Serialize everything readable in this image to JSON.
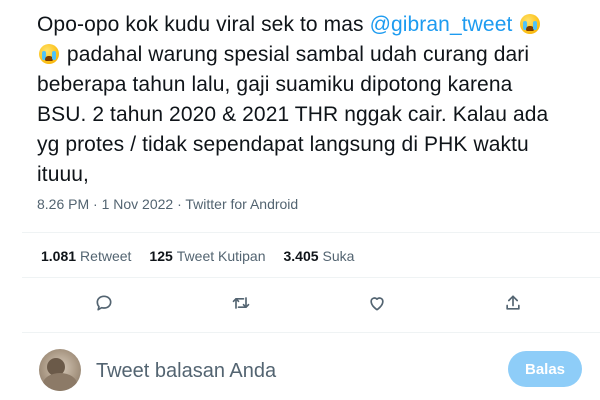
{
  "tweet": {
    "lines": [
      {
        "before": "Opo-opo kok kudu viral sek to mas ",
        "mention": "@gibran_tweet",
        "emoji": "loudly-crying-face"
      },
      {
        "emoji": "loudly-crying-face",
        "after": " padahal warung spesial sambal udah curang dari"
      },
      {
        "text": "beberapa tahun lalu, gaji suamiku dipotong karena"
      },
      {
        "text": "BSU. 2 tahun 2020 & 2021 THR nggak cair. Kalau ada"
      },
      {
        "text": "yg protes / tidak sependapat langsung di PHK waktu"
      },
      {
        "text": "ituuu,"
      }
    ],
    "meta": "8.26 PM · 1 Nov 2022 · Twitter for Android"
  },
  "stats": {
    "retweets": {
      "count": "1.081",
      "label": "Retweet"
    },
    "quotes": {
      "count": "125",
      "label": "Tweet Kutipan"
    },
    "likes": {
      "count": "3.405",
      "label": "Suka"
    }
  },
  "actions": [
    {
      "icon": "reply-icon"
    },
    {
      "icon": "retweet-icon"
    },
    {
      "icon": "like-icon"
    },
    {
      "icon": "share-icon"
    }
  ],
  "reply": {
    "placeholder": "Tweet balasan Anda",
    "button_label": "Balas"
  },
  "colors": {
    "accent": "#1d9bf0",
    "reply_button_disabled": "#8ecdf8",
    "text_primary": "#0f1419",
    "text_secondary": "#536471",
    "divider": "#eff3f4"
  }
}
